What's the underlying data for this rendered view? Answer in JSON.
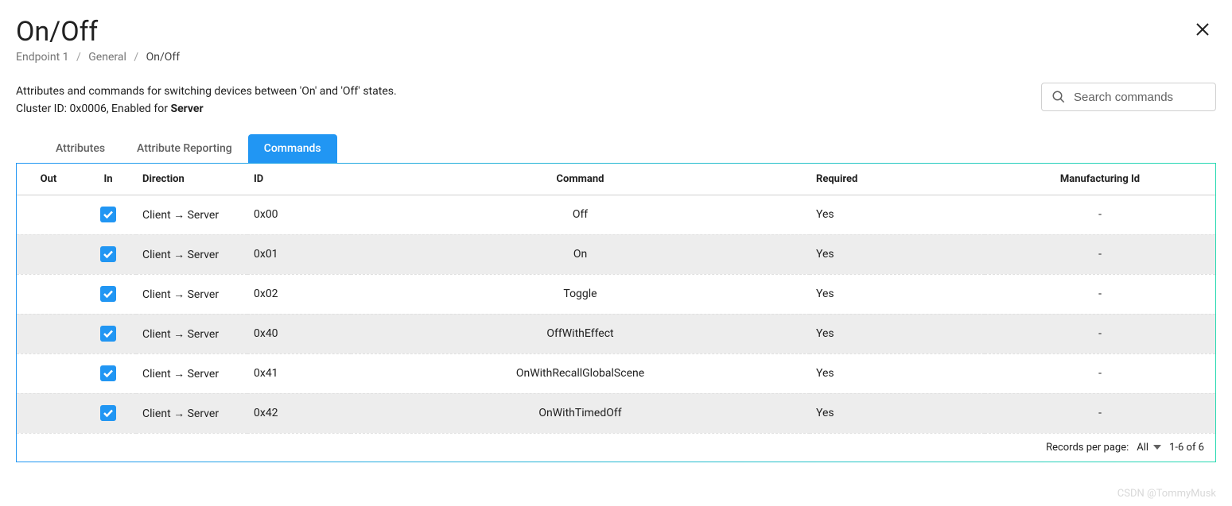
{
  "header": {
    "title": "On/Off",
    "breadcrumb": {
      "a": "Endpoint 1",
      "b": "General",
      "c": "On/Off"
    }
  },
  "desc": {
    "line1": "Attributes and commands for switching devices between 'On' and 'Off' states.",
    "prefix": "Cluster ID: 0x0006, Enabled for ",
    "bold": "Server"
  },
  "search": {
    "placeholder": "Search commands"
  },
  "tabs": {
    "a": "Attributes",
    "b": "Attribute Reporting",
    "c": "Commands"
  },
  "table": {
    "headers": {
      "out": "Out",
      "in": "In",
      "dir": "Direction",
      "id": "ID",
      "cmd": "Command",
      "req": "Required",
      "mfg": "Manufacturing Id"
    },
    "rows": [
      {
        "direction": "Client → Server",
        "id": "0x00",
        "command": "Off",
        "required": "Yes",
        "mfg": "-"
      },
      {
        "direction": "Client → Server",
        "id": "0x01",
        "command": "On",
        "required": "Yes",
        "mfg": "-"
      },
      {
        "direction": "Client → Server",
        "id": "0x02",
        "command": "Toggle",
        "required": "Yes",
        "mfg": "-"
      },
      {
        "direction": "Client → Server",
        "id": "0x40",
        "command": "OffWithEffect",
        "required": "Yes",
        "mfg": "-"
      },
      {
        "direction": "Client → Server",
        "id": "0x41",
        "command": "OnWithRecallGlobalScene",
        "required": "Yes",
        "mfg": "-"
      },
      {
        "direction": "Client → Server",
        "id": "0x42",
        "command": "OnWithTimedOff",
        "required": "Yes",
        "mfg": "-"
      }
    ]
  },
  "footer": {
    "rpp_label": "Records per page:",
    "rpp_value": "All",
    "range": "1-6 of 6"
  },
  "watermark": "CSDN @TommyMusk"
}
